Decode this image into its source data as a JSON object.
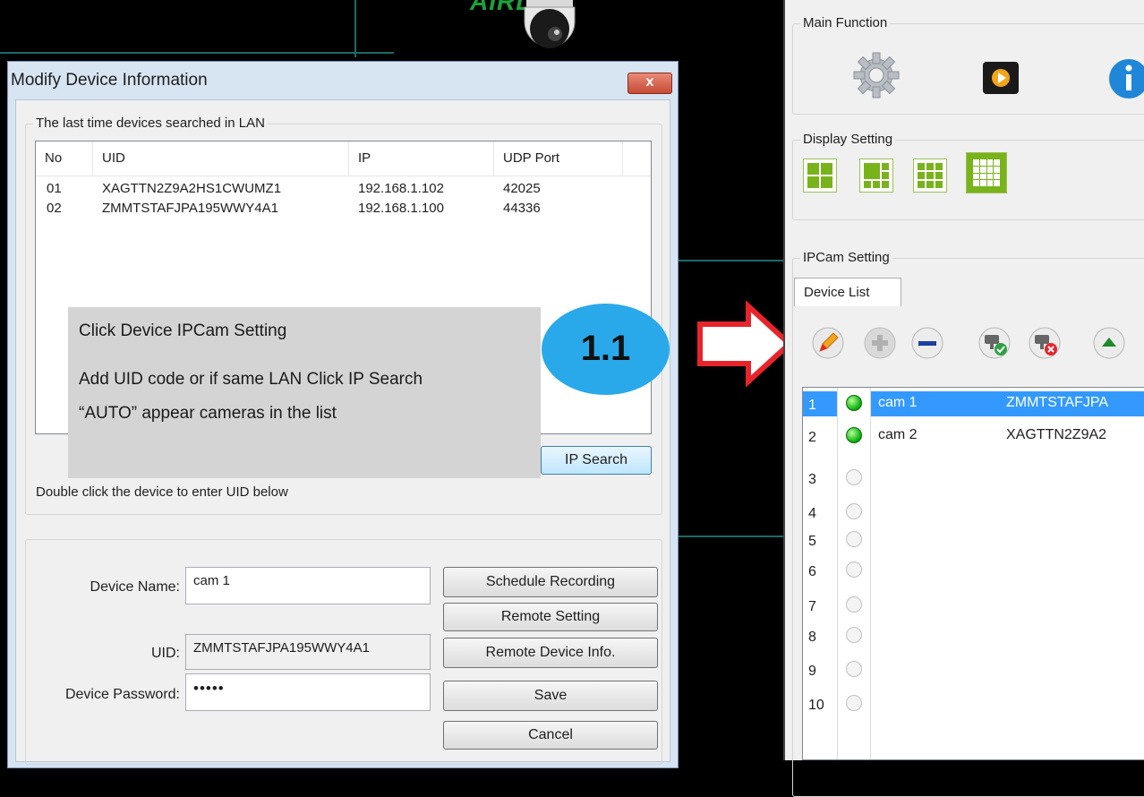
{
  "background": {
    "logo_text": "AIRLINK"
  },
  "dialog": {
    "title": "Modify Device Information",
    "close_label": "x",
    "search_group_label": "The last time devices searched in LAN",
    "table": {
      "columns": [
        "No",
        "UID",
        "IP",
        "UDP Port"
      ],
      "rows": [
        {
          "no": "01",
          "uid": "XAGTTN2Z9A2HS1CWUMZ1",
          "ip": "192.168.1.102",
          "port": "42025"
        },
        {
          "no": "02",
          "uid": "ZMMTSTAFJPA195WWY4A1",
          "ip": "192.168.1.100",
          "port": "44336"
        }
      ]
    },
    "ip_search_label": "IP Search",
    "hint": "Double click the device to enter UID below",
    "device_name_label": "Device Name:",
    "device_name_value": "cam 1",
    "uid_label": "UID:",
    "uid_value": "ZMMTSTAFJPA195WWY4A1",
    "password_label": "Device Password:",
    "password_value": "•••••",
    "buttons": {
      "schedule": "Schedule Recording",
      "remote_setting": "Remote Setting",
      "remote_info": "Remote Device Info.",
      "save": "Save",
      "cancel": "Cancel"
    }
  },
  "annotation": {
    "line1": "Click Device IPCam Setting",
    "line2": "Add UID code or if same LAN Click IP Search",
    "line3": "“AUTO” appear cameras in the list",
    "badge": "1.1"
  },
  "right_panel": {
    "main_function_label": "Main Function",
    "display_setting_label": "Display Setting",
    "ipcam_setting_label": "IPCam Setting",
    "tab_label": "Device List",
    "colors": {
      "accent_green": "#79b31c",
      "selection_blue": "#3399ff",
      "badge_blue": "#2aa9ea",
      "arrow_red": "#e8242b"
    },
    "cameras": [
      {
        "num": "1",
        "name": "cam 1",
        "uid": "ZMMTSTAFJPA",
        "online": true,
        "selected": true
      },
      {
        "num": "2",
        "name": "cam 2",
        "uid": "XAGTTN2Z9A2",
        "online": true,
        "selected": false
      },
      {
        "num": "3",
        "name": "",
        "uid": "",
        "online": false,
        "selected": false
      },
      {
        "num": "4",
        "name": "",
        "uid": "",
        "online": false,
        "selected": false
      },
      {
        "num": "5",
        "name": "",
        "uid": "",
        "online": false,
        "selected": false
      },
      {
        "num": "6",
        "name": "",
        "uid": "",
        "online": false,
        "selected": false
      },
      {
        "num": "7",
        "name": "",
        "uid": "",
        "online": false,
        "selected": false
      },
      {
        "num": "8",
        "name": "",
        "uid": "",
        "online": false,
        "selected": false
      },
      {
        "num": "9",
        "name": "",
        "uid": "",
        "online": false,
        "selected": false
      },
      {
        "num": "10",
        "name": "",
        "uid": "",
        "online": false,
        "selected": false
      }
    ]
  }
}
